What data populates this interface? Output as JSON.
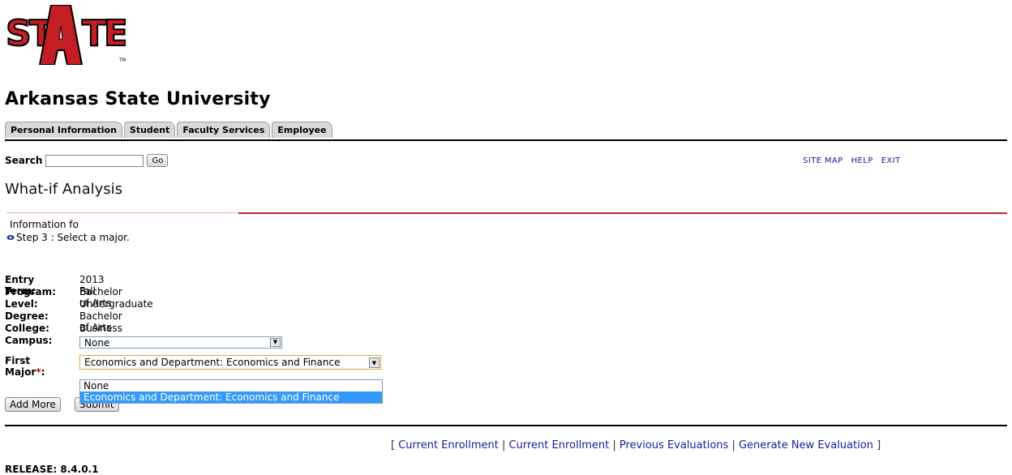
{
  "header": {
    "logo_text": "STATE",
    "university": "Arkansas State University"
  },
  "tabs": [
    "Personal Information",
    "Student",
    "Faculty Services",
    "Employee"
  ],
  "search": {
    "label": "Search",
    "value": "",
    "go_label": "Go"
  },
  "toplinks": [
    "SITE MAP",
    "HELP",
    "EXIT"
  ],
  "page_title": "What-if Analysis",
  "info_text": "Information fo",
  "step_text": "Step 3 : Select a major.",
  "fields": {
    "entry_term": {
      "label": "Entry Term:",
      "value": "2013 Fall"
    },
    "program": {
      "label": "Program:",
      "value": "Bachelor of Arts"
    },
    "level": {
      "label": "Level:",
      "value": "Undergraduate"
    },
    "degree": {
      "label": "Degree:",
      "value": "Bachelor of Arts"
    },
    "college": {
      "label": "College:",
      "value": "Business"
    },
    "campus": {
      "label": "Campus:",
      "value": "None"
    },
    "first_major": {
      "label": "First Major",
      "required_mark": "*",
      "colon": ":",
      "value": "Economics and Department: Economics and Finance"
    }
  },
  "first_major_options": [
    "None",
    "Economics and Department: Economics and Finance"
  ],
  "buttons": {
    "add_more": "Add More",
    "submit": "Submit"
  },
  "footer_links": {
    "open": "[",
    "close": "]",
    "sep": "|",
    "items": [
      "Current Enrollment",
      "Current Enrollment",
      "Previous Evaluations",
      "Generate New Evaluation"
    ]
  },
  "release": "RELEASE: 8.4.0.1",
  "colors": {
    "accent_red": "#c0282e",
    "link_blue": "#1a1aa6",
    "selected_blue": "#3399ff"
  }
}
